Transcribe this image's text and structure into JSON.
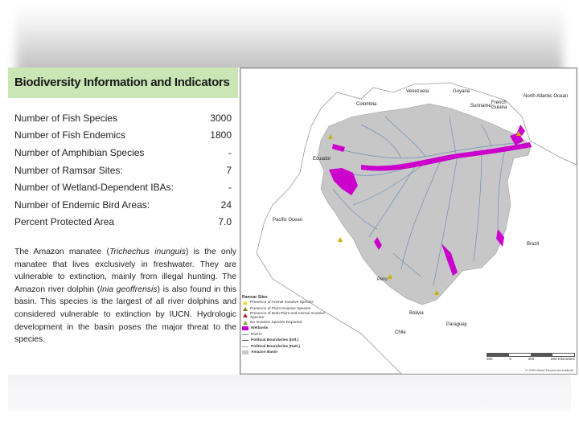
{
  "heading": "Biodiversity Information and Indicators",
  "stats": [
    {
      "label": "Number of Fish Species",
      "value": "3000"
    },
    {
      "label": "Number of Fish Endemics",
      "value": "1800"
    },
    {
      "label": "Number of Amphibian Species",
      "value": "-"
    },
    {
      "label": "Number of Ramsar Sites:",
      "value": "7"
    },
    {
      "label": "Number of Wetland-Dependent IBAs:",
      "value": "-"
    },
    {
      "label": "Number of Endemic Bird Areas:",
      "value": "24"
    },
    {
      "label": "Percent Protected Area",
      "value": "7.0"
    }
  ],
  "paragraph": {
    "p1": "The Amazon manatee (",
    "sci1": "Trichechus inunguis",
    "p2": ") is the only manatee that lives exclusively in freshwater. They are vulnerable to extinction, mainly from illegal hunting. The Amazon river dolphin (",
    "sci2": "Inia geoffrensis",
    "p3": ") is also found in this basin. This species is the largest of all river dolphins and considered vulnerable to extinction by IUCN. Hydrologic development in the basin poses the major threat to the species."
  },
  "map": {
    "labels": {
      "venezuela": "Venezuela",
      "guyana": "Guyana",
      "suriname": "Suriname",
      "french_guiana": "French Guiana",
      "north_atlantic": "North Atlantic Ocean",
      "colombia": "Colombia",
      "ecuador": "Ecuador",
      "pacific": "Pacific Ocean",
      "brazil": "Brazil",
      "peru": "Peru",
      "bolivia": "Bolivia",
      "chile": "Chile",
      "paraguay": "Paraguay"
    },
    "legend": {
      "title": "Ramsar Sites",
      "items": [
        "Presence of Animal Invasive Species",
        "Presence of Plant Invasive Species",
        "Presence of Both Plant and Animal Invasive Species",
        "No Invasive Species Reported"
      ],
      "wetlands": "Wetlands",
      "rivers": "Rivers",
      "intl": "Political Boundaries (Intl.)",
      "natl": "Political Boundaries (Natl.)",
      "basin": "Amazon Basin"
    },
    "scale_ticks": [
      "300",
      "0",
      "300",
      "600 Kilometers"
    ],
    "credit": "© 2003 World Resources Institute",
    "colors": {
      "wetlands": "#cc00cc",
      "basin": "#c7c7c7",
      "rivers": "#6f8fb8",
      "ocean": "#ffffff",
      "land": "#ffffff"
    }
  }
}
